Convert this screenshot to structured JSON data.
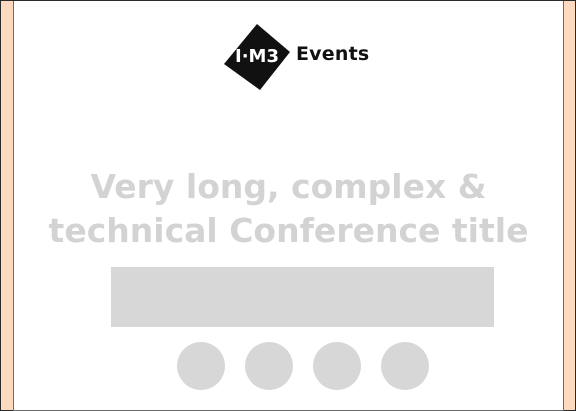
{
  "brand": {
    "logo_mark_text": "I·M3",
    "logo_text": "Events"
  },
  "hero": {
    "title_line_1": "Very long, complex &",
    "title_line_2": "technical Conference title"
  },
  "placeholders": {
    "social_icons": [
      "social-icon-1",
      "social-icon-2",
      "social-icon-3",
      "social-icon-4"
    ]
  },
  "colors": {
    "page_background": "#fcd9bf",
    "card_background": "#ffffff",
    "title_color": "#d3d3d3",
    "placeholder_gray": "#d7d7d7",
    "logo_black": "#111111"
  }
}
